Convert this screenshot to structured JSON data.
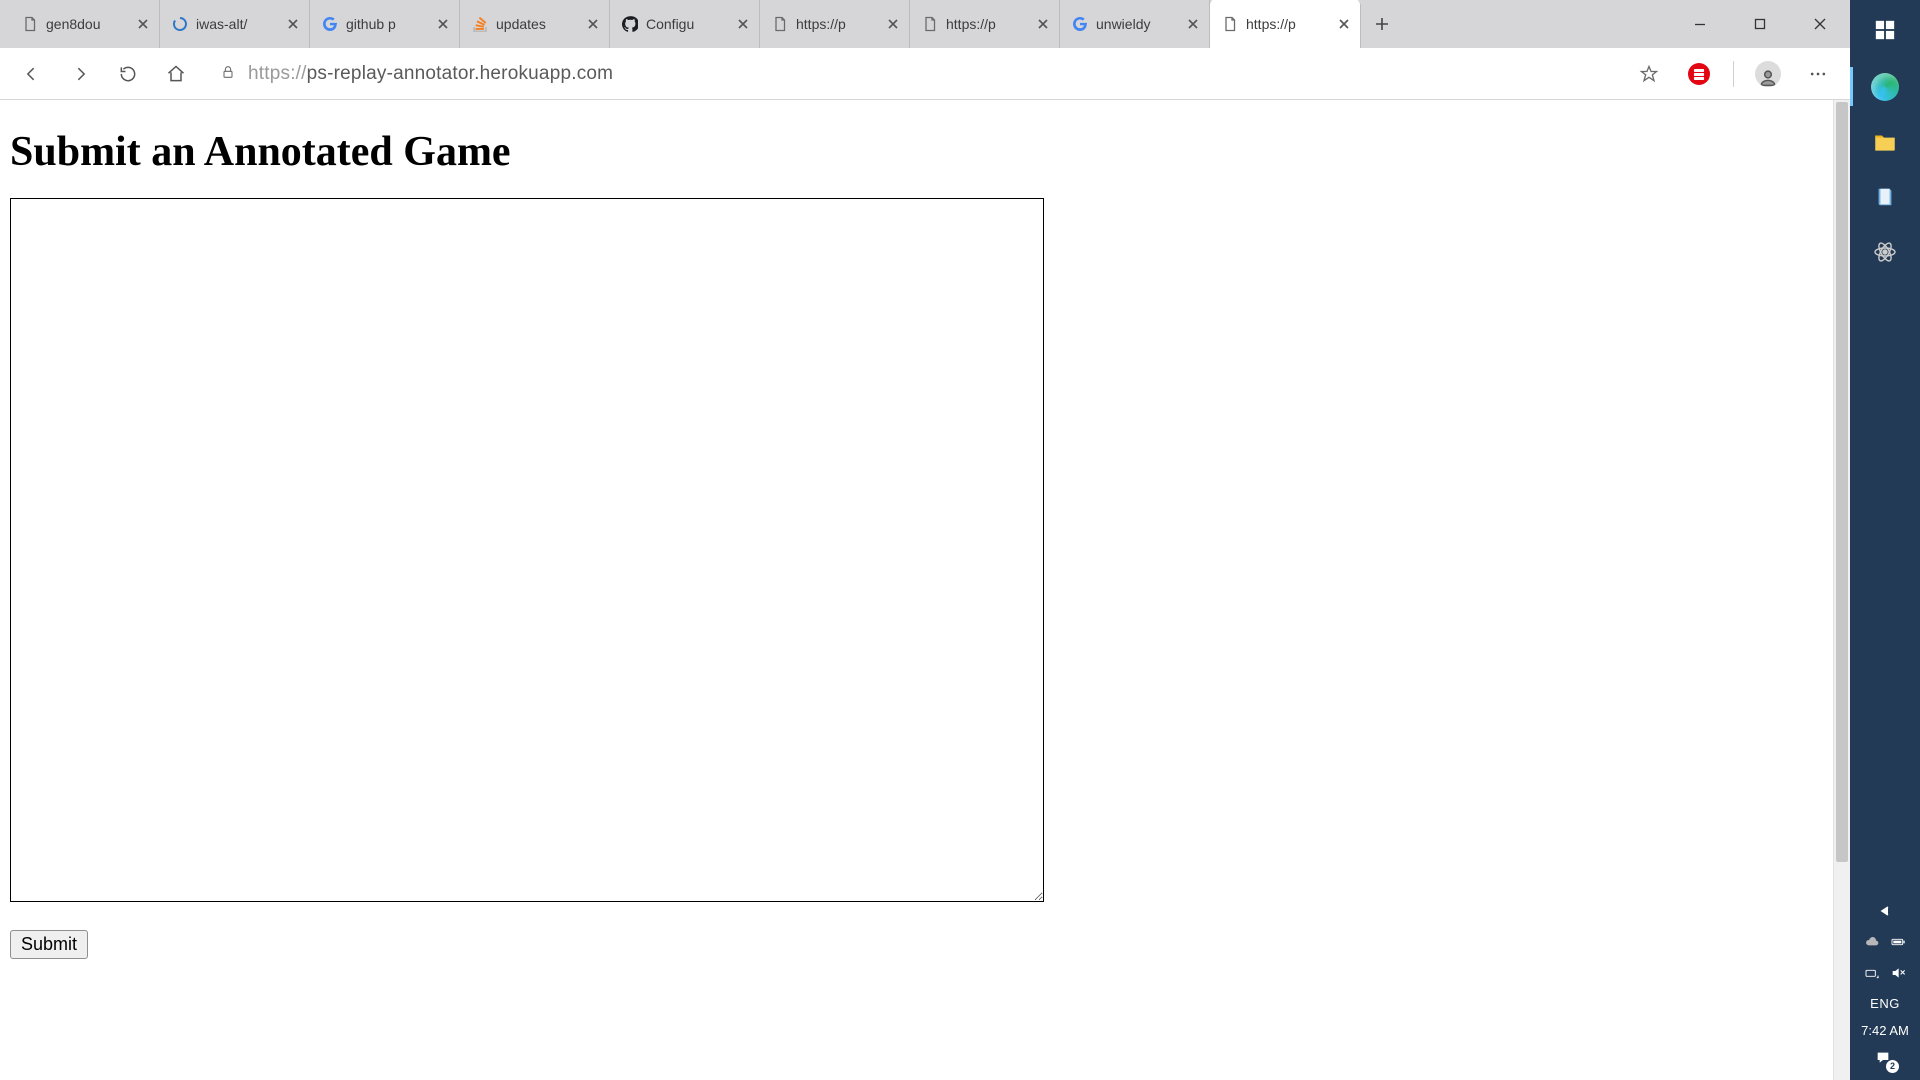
{
  "window_controls": {
    "minimize": "",
    "maximize": "",
    "close": ""
  },
  "tabs": [
    {
      "title": "gen8dou",
      "favicon": "page"
    },
    {
      "title": "iwas-alt/",
      "favicon": "spinner"
    },
    {
      "title": "github p",
      "favicon": "google"
    },
    {
      "title": "updates",
      "favicon": "stack"
    },
    {
      "title": "Configu",
      "favicon": "github"
    },
    {
      "title": "https://p",
      "favicon": "page"
    },
    {
      "title": "https://p",
      "favicon": "page"
    },
    {
      "title": "unwieldy",
      "favicon": "google"
    },
    {
      "title": "https://p",
      "favicon": "page",
      "active": true
    }
  ],
  "toolbar": {
    "url_scheme": "https://",
    "url_rest": "ps-replay-annotator.herokuapp.com"
  },
  "page": {
    "heading": "Submit an Annotated Game",
    "textarea_value": "",
    "submit_label": "Submit"
  },
  "taskbar": {
    "lang": "ENG",
    "clock": "7:42 AM",
    "notif_count": "2"
  }
}
